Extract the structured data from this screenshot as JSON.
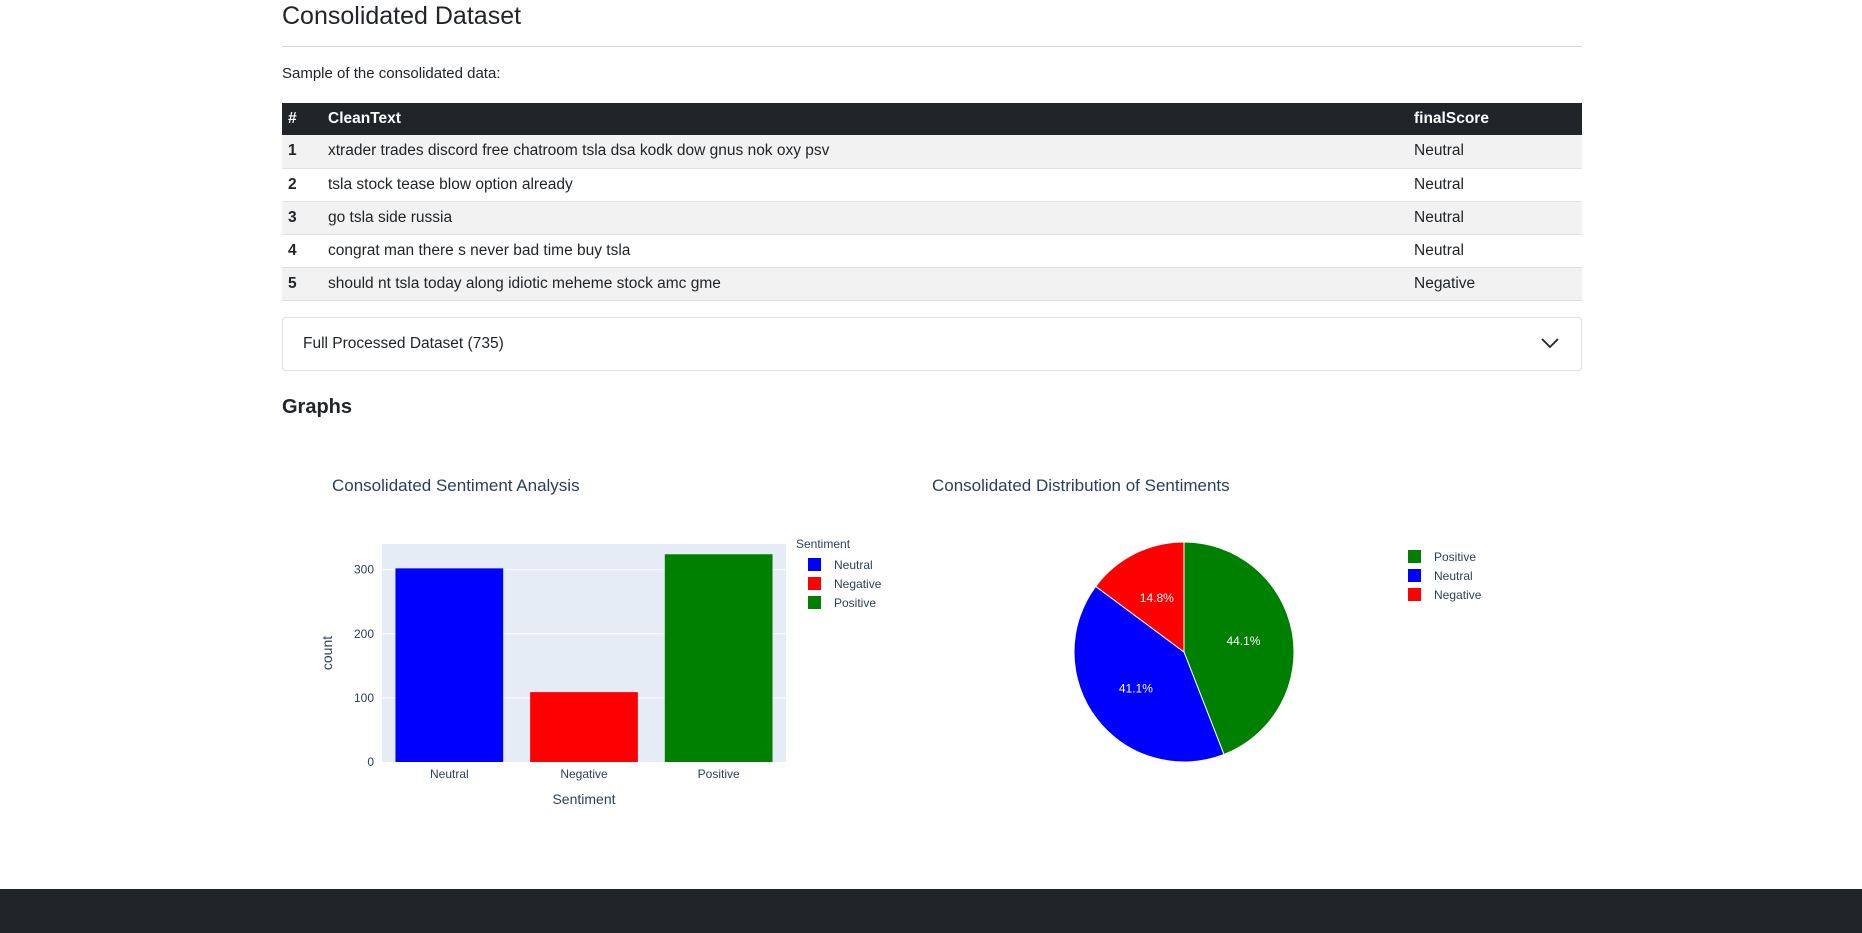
{
  "section": {
    "title": "Consolidated Dataset",
    "sample_label": "Sample of the consolidated data:"
  },
  "table": {
    "headers": [
      "#",
      "CleanText",
      "finalScore"
    ],
    "rows": [
      {
        "idx": "1",
        "text": "xtrader trades discord free chatroom tsla dsa kodk dow gnus nok oxy psv",
        "score": "Neutral"
      },
      {
        "idx": "2",
        "text": "tsla stock tease blow option already",
        "score": "Neutral"
      },
      {
        "idx": "3",
        "text": "go tsla side russia",
        "score": "Neutral"
      },
      {
        "idx": "4",
        "text": "congrat man there s never bad time buy tsla",
        "score": "Neutral"
      },
      {
        "idx": "5",
        "text": "should nt tsla today along idiotic meheme stock amc gme",
        "score": "Negative"
      }
    ]
  },
  "accordion": {
    "label": "Full Processed Dataset (735)",
    "icon": "chevron-down-icon"
  },
  "graphs": {
    "heading": "Graphs"
  },
  "colors": {
    "Neutral": "#0000ff",
    "Negative": "#ff0000",
    "Positive": "#008000",
    "plot_bg": "#e5ecf6",
    "text": "#2a3f5f"
  },
  "chart_data": [
    {
      "type": "bar",
      "title": "Consolidated Sentiment Analysis",
      "xlabel": "Sentiment",
      "ylabel": "count",
      "categories": [
        "Neutral",
        "Negative",
        "Positive"
      ],
      "values": [
        302,
        109,
        324
      ],
      "ylim": [
        0,
        340
      ],
      "yticks": [
        0,
        100,
        200,
        300
      ],
      "grid": true,
      "legend": {
        "title": "Sentiment",
        "position": "right",
        "entries": [
          "Neutral",
          "Negative",
          "Positive"
        ]
      }
    },
    {
      "type": "pie",
      "title": "Consolidated Distribution of Sentiments",
      "labels": [
        "Positive",
        "Neutral",
        "Negative"
      ],
      "values": [
        324,
        302,
        109
      ],
      "percent_labels": [
        "44.1%",
        "41.1%",
        "14.8%"
      ],
      "legend": {
        "position": "right",
        "entries": [
          "Positive",
          "Neutral",
          "Negative"
        ]
      }
    }
  ]
}
